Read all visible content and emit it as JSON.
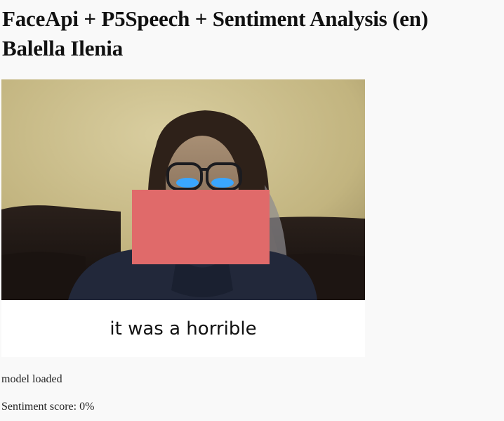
{
  "header": {
    "title_line1": "FaceApi + P5Speech + Sentiment Analysis (en)",
    "title_line2": "Balella Ilenia"
  },
  "sketch": {
    "caption": "it was a horrible",
    "face_box_color": "#e06a6a"
  },
  "status": {
    "model": "model loaded",
    "sentiment_label": "Sentiment score: ",
    "sentiment_value": "0%"
  }
}
